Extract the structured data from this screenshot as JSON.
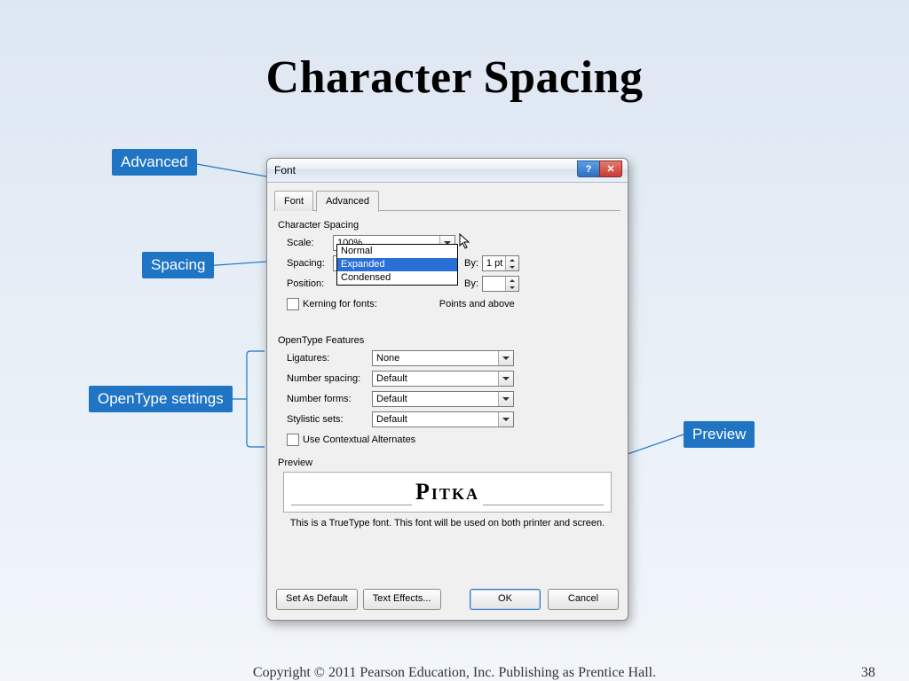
{
  "slide": {
    "title": "Character Spacing",
    "footer_copy": "Copyright © 2011 Pearson Education, Inc. Publishing as Prentice Hall.",
    "footer_num": "38"
  },
  "callouts": {
    "advanced": "Advanced",
    "spacing": "Spacing",
    "opentype": "OpenType settings",
    "preview": "Preview"
  },
  "dialog": {
    "title": "Font",
    "tabs": {
      "font": "Font",
      "advanced": "Advanced"
    },
    "char_spacing_heading": "Character Spacing",
    "scale_label": "Scale:",
    "scale_value": "100%",
    "spacing_label": "Spacing:",
    "spacing_value": "Expanded",
    "spacing_options": [
      "Normal",
      "Expanded",
      "Condensed"
    ],
    "by_label": "By:",
    "by_value": "1 pt",
    "position_label": "Position:",
    "kerning_label": "Kerning for fonts:",
    "points_above": "Points and above",
    "opentype_heading": "OpenType Features",
    "ligatures_label": "Ligatures:",
    "ligatures_value": "None",
    "numspacing_label": "Number spacing:",
    "numspacing_value": "Default",
    "numforms_label": "Number forms:",
    "numforms_value": "Default",
    "stylistic_label": "Stylistic sets:",
    "stylistic_value": "Default",
    "contextual_label": "Use Contextual Alternates",
    "preview_heading": "Preview",
    "preview_sample": "Pitka",
    "preview_note": "This is a TrueType font. This font will be used on both printer and screen.",
    "btn_setdefault": "Set As Default",
    "btn_texteffects": "Text Effects...",
    "btn_ok": "OK",
    "btn_cancel": "Cancel"
  }
}
